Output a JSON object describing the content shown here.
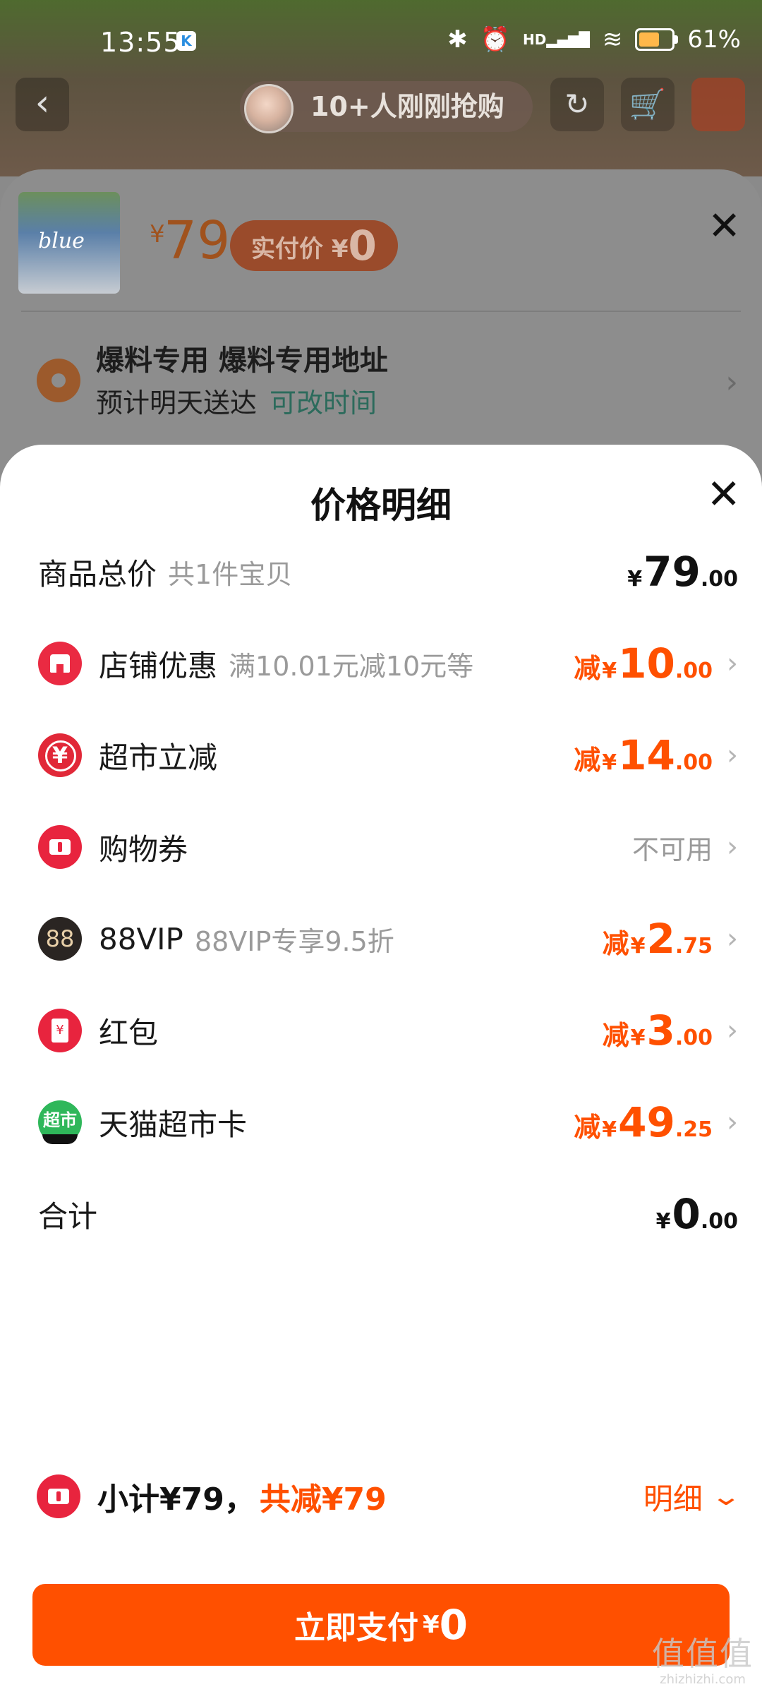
{
  "status": {
    "time": "13:55",
    "k_badge": "K",
    "signal_label": "HD",
    "battery": "61%"
  },
  "background": {
    "buyers": "10+人刚刚抢购",
    "product": {
      "price_symbol": "¥",
      "price": "79",
      "actual_price_label": "实付价 ¥",
      "actual_price_value": "0"
    },
    "address": {
      "name": "爆料专用 爆料专用地址",
      "eta": "预计明天送达",
      "change_time": "可改时间"
    }
  },
  "sheet": {
    "title": "价格明细",
    "rows": [
      {
        "label": "商品总价",
        "sub": "共1件宝贝",
        "prefix": "",
        "yen": "¥",
        "int": "79",
        "dec": ".00"
      },
      {
        "label": "店铺优惠",
        "sub": "满10.01元减10元等",
        "prefix": "减",
        "yen": "¥",
        "int": "10",
        "dec": ".00"
      },
      {
        "label": "超市立减",
        "sub": "",
        "prefix": "减",
        "yen": "¥",
        "int": "14",
        "dec": ".00"
      },
      {
        "label": "购物券",
        "sub": "",
        "value_text": "不可用"
      },
      {
        "label": "88VIP",
        "sub": "88VIP专享9.5折",
        "prefix": "减",
        "yen": "¥",
        "int": "2",
        "dec": ".75",
        "icon_text": "88"
      },
      {
        "label": "红包",
        "sub": "",
        "prefix": "减",
        "yen": "¥",
        "int": "3",
        "dec": ".00"
      },
      {
        "label": "天猫超市卡",
        "sub": "",
        "prefix": "减",
        "yen": "¥",
        "int": "49",
        "dec": ".25",
        "icon_text": "超市"
      },
      {
        "label": "合计",
        "sub": "",
        "prefix": "",
        "yen": "¥",
        "int": "0",
        "dec": ".00"
      }
    ]
  },
  "footer": {
    "subtotal": "小计¥79，",
    "saving": "共减¥79",
    "detail_link": "明细",
    "pay_label": "立即支付",
    "pay_yen": "¥",
    "pay_amount": "0"
  },
  "watermark": {
    "logo": "值值值",
    "site": "zhizhizhi.com"
  },
  "colors": {
    "accent": "#ff5000",
    "icon_red": "#e8243e",
    "tmall_card_green": "#2fb75a"
  },
  "icons": {
    "close": "close-icon",
    "chevron": "chevron-right-icon",
    "back": "back-arrow-icon",
    "location": "location-pin-icon"
  }
}
